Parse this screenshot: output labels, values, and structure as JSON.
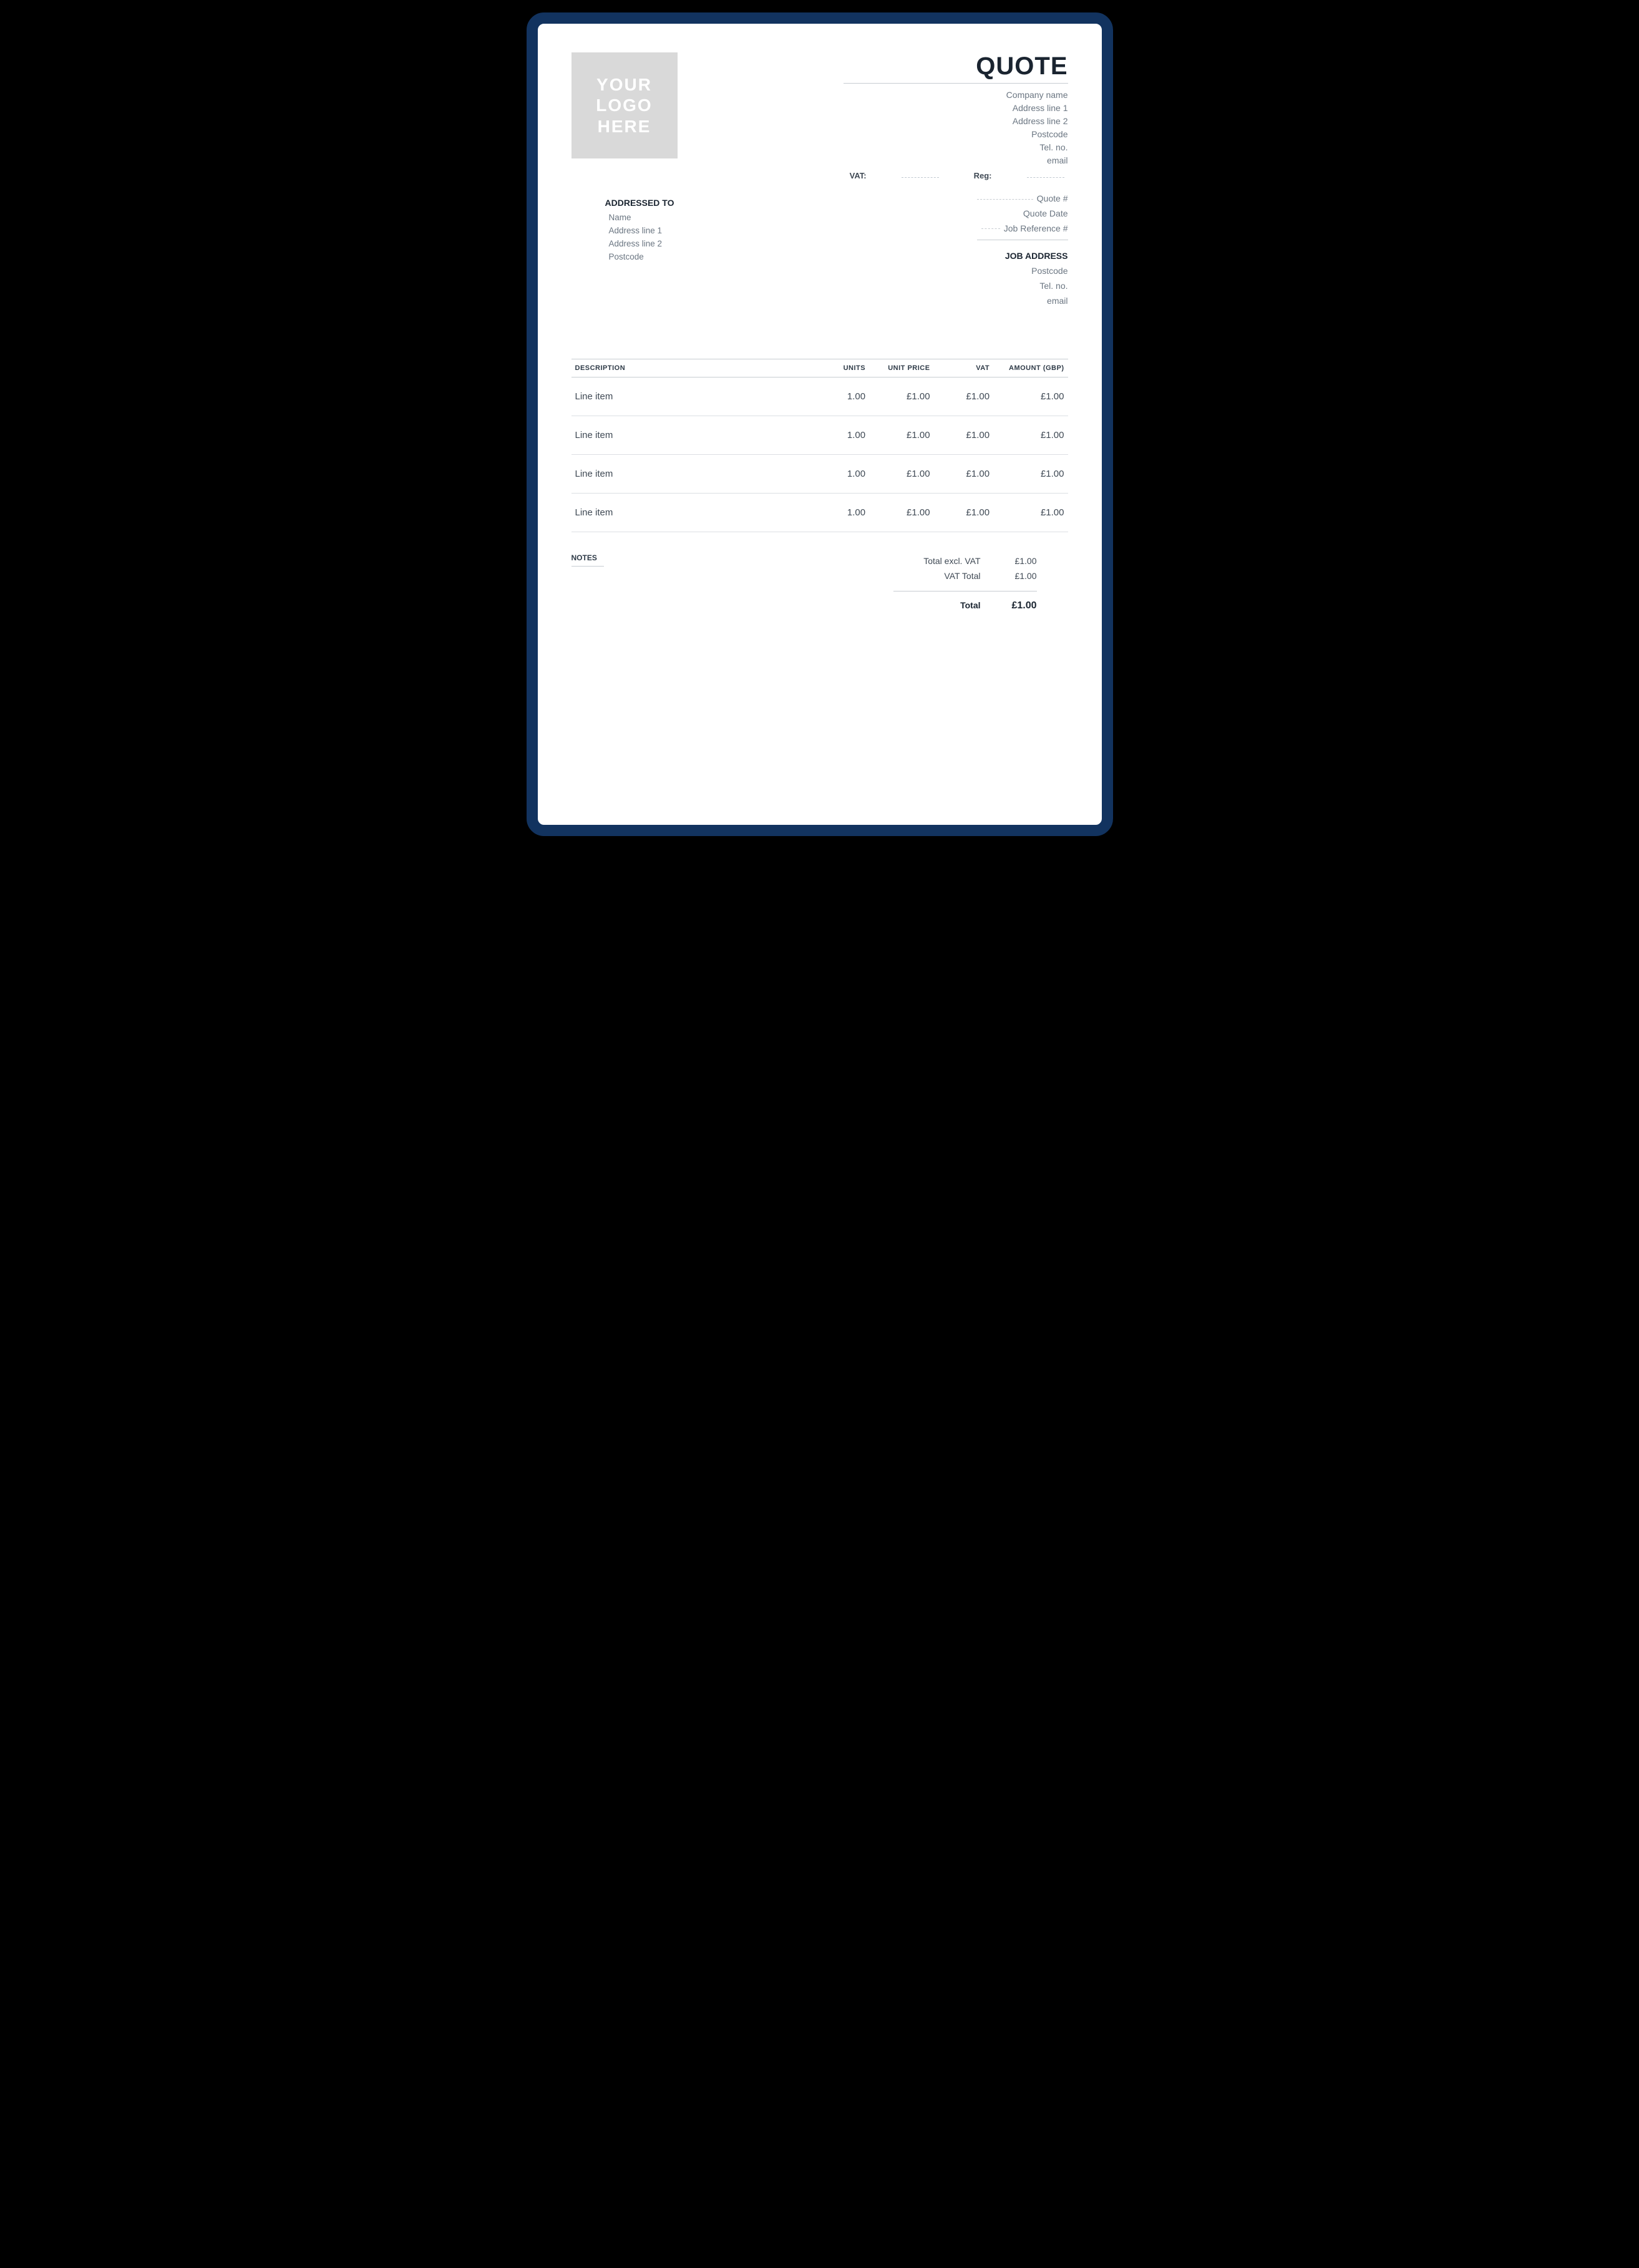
{
  "document": {
    "title": "QUOTE",
    "logo_line1": "YOUR",
    "logo_line2": "LOGO",
    "logo_line3": "HERE"
  },
  "company": {
    "name": "Company name",
    "address1": "Address line 1",
    "address2": "Address line 2",
    "postcode": "Postcode",
    "tel": "Tel. no.",
    "email": "email",
    "vat_label": "VAT:",
    "reg_label": "Reg:"
  },
  "addressed": {
    "heading": "ADDRESSED TO",
    "name": "Name",
    "address1": "Address line 1",
    "address2": "Address line 2",
    "postcode": "Postcode"
  },
  "meta": {
    "quote_no_label": "Quote #",
    "quote_date_label": "Quote Date",
    "job_ref_label": "Job Reference #",
    "job_address_heading": "JOB ADDRESS",
    "postcode": "Postcode",
    "tel": "Tel. no.",
    "email": "email"
  },
  "columns": {
    "description": "DESCRIPTION",
    "units": "UNITS",
    "unit_price": "UNIT PRICE",
    "vat": "VAT",
    "amount": "AMOUNT (GBP)"
  },
  "items": [
    {
      "description": "Line item",
      "units": "1.00",
      "unit_price": "£1.00",
      "vat": "£1.00",
      "amount": "£1.00"
    },
    {
      "description": "Line item",
      "units": "1.00",
      "unit_price": "£1.00",
      "vat": "£1.00",
      "amount": "£1.00"
    },
    {
      "description": "Line item",
      "units": "1.00",
      "unit_price": "£1.00",
      "vat": "£1.00",
      "amount": "£1.00"
    },
    {
      "description": "Line item",
      "units": "1.00",
      "unit_price": "£1.00",
      "vat": "£1.00",
      "amount": "£1.00"
    }
  ],
  "notes": {
    "heading": "NOTES"
  },
  "totals": {
    "excl_vat_label": "Total excl. VAT",
    "excl_vat_value": "£1.00",
    "vat_total_label": "VAT Total",
    "vat_total_value": "£1.00",
    "grand_label": "Total",
    "grand_value": "£1.00"
  }
}
